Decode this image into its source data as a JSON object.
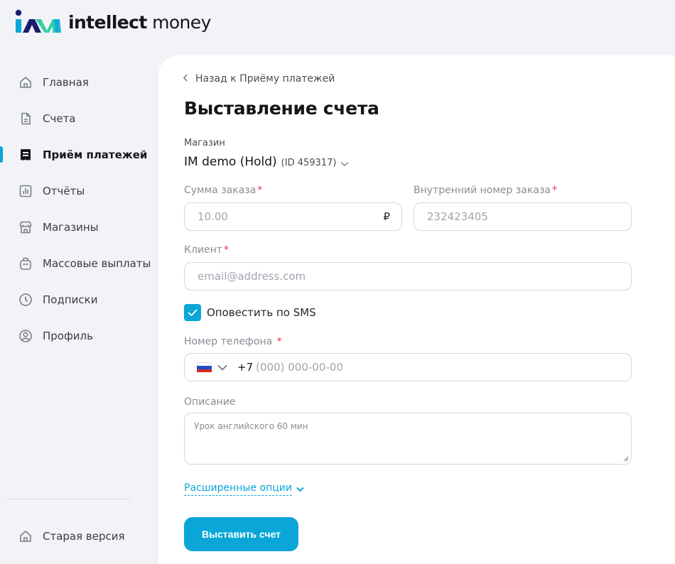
{
  "brand": {
    "name_bold": "intellect",
    "name_regular": " money",
    "accent": "#0aa6d8"
  },
  "sidebar": {
    "items": [
      {
        "label": "Главная",
        "icon": "home-icon",
        "active": false
      },
      {
        "label": "Счета",
        "icon": "document-icon",
        "active": false
      },
      {
        "label": "Приём платежей",
        "icon": "receipt-icon",
        "active": true
      },
      {
        "label": "Отчёты",
        "icon": "bar-chart-icon",
        "active": false
      },
      {
        "label": "Магазины",
        "icon": "store-icon",
        "active": false
      },
      {
        "label": "Массовые выплаты",
        "icon": "bag-icon",
        "active": false
      },
      {
        "label": "Подписки",
        "icon": "clock-icon",
        "active": false
      },
      {
        "label": "Профиль",
        "icon": "user-icon",
        "active": false
      }
    ],
    "old_version": {
      "label": "Старая версия",
      "icon": "home-icon"
    }
  },
  "main": {
    "back_link": "Назад к Приёму платежей",
    "title": "Выставление счета",
    "shop": {
      "label": "Магазин",
      "name": "IM demo (Hold)",
      "id": "(ID 459317)"
    },
    "order_sum": {
      "label": "Сумма заказа",
      "placeholder": "10.00",
      "currency": "₽"
    },
    "internal_order": {
      "label": "Внутренний номер заказа",
      "placeholder": "232423405"
    },
    "client": {
      "label": "Клиент",
      "placeholder": "email@address.com"
    },
    "sms_notify": {
      "label": "Оповестить по SMS",
      "checked": true
    },
    "phone": {
      "label": "Номер телефона",
      "prefix": "+7",
      "placeholder": "(000) 000-00-00",
      "country_flag": "russia-flag-icon"
    },
    "description": {
      "label": "Описание",
      "placeholder": "Урок английского 60 мин"
    },
    "advanced_options": "Расширенные опции",
    "submit": "Выставить счет",
    "required_mark": "*"
  }
}
